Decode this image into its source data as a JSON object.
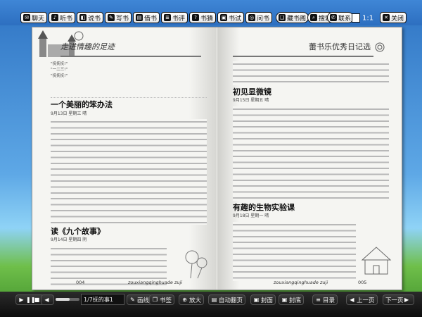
{
  "toolbar": {
    "chat": "聊天",
    "listen": "听书",
    "say": "说书",
    "write": "写书",
    "borrow": "借书",
    "review": "书评",
    "guess": "书猜",
    "test": "书试",
    "ask": "问书",
    "shelf": "藏书阁",
    "search": "搜索",
    "contact": "联系",
    "page": "1:1",
    "close": "关闭"
  },
  "left_page": {
    "header": "走进情趣的足迹",
    "intro_lines": [
      "\"抚抚抚!\"",
      "\"一二三!\"",
      "\"抚抚抚!\""
    ],
    "article1": {
      "title": "一个美丽的笨办法",
      "meta": "9月13日 星期三 晴"
    },
    "article2": {
      "title": "读《九个故事》",
      "meta": "9月14日 星期四 阴"
    },
    "footer_num": "004",
    "footer_url": "zouxiangqinghuade zuji"
  },
  "right_page": {
    "header": "蕾书乐优秀日记选",
    "article1": {
      "title": "初见显微镜",
      "meta": "9月15日 星期五 晴"
    },
    "article2": {
      "title": "有趣的生物实验课",
      "meta": "9月18日 星期一 晴"
    },
    "footer_url": "zouxiangqinghuade zuji",
    "footer_num": "005"
  },
  "bottombar": {
    "chapter": "1/7抚的事1",
    "draw": "画线",
    "bookmark": "书签",
    "zoom": "放大",
    "autoflip": "自动翻页",
    "cover": "封面",
    "backcover": "封底",
    "toc": "目录",
    "prev": "上一页",
    "next": "下一页"
  }
}
